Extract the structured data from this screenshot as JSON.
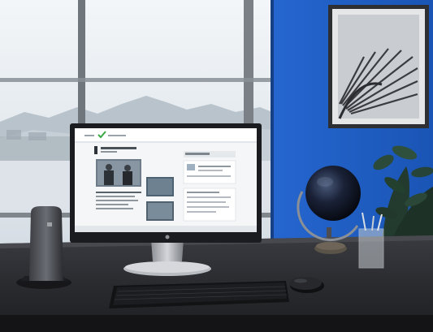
{
  "scene": {
    "colors": {
      "wall_blue": "#1f5fc4",
      "window_sky": "#e8eef3",
      "desk_top": "#2b2c30",
      "monitor_bezel": "#1b1c1f",
      "screen_bg": "#f4f6f8",
      "accent_green": "#39a845"
    },
    "objects": [
      "window",
      "blue-wall",
      "framed-art",
      "desk",
      "monitor",
      "thin-client",
      "keyboard",
      "mouse",
      "globe",
      "pen-holder",
      "plant"
    ]
  }
}
